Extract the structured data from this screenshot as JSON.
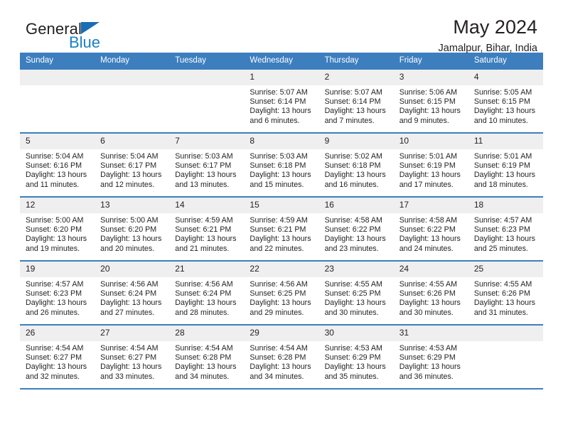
{
  "brand": {
    "name_part1": "General",
    "name_part2": "Blue",
    "logo_icon": "triangle-flag-icon"
  },
  "header": {
    "title": "May 2024",
    "subtitle": "Jamalpur, Bihar, India"
  },
  "weekday_headers": [
    "Sunday",
    "Monday",
    "Tuesday",
    "Wednesday",
    "Thursday",
    "Friday",
    "Saturday"
  ],
  "labels": {
    "sunrise_prefix": "Sunrise:",
    "sunset_prefix": "Sunset:",
    "daylight_prefix": "Daylight:"
  },
  "colors": {
    "header_blue": "#3d7ebf",
    "daynum_band": "#efefef",
    "brand_blue": "#1a7ec4",
    "text": "#231f20"
  },
  "weeks": [
    [
      {
        "day": "",
        "empty": true
      },
      {
        "day": "",
        "empty": true
      },
      {
        "day": "",
        "empty": true
      },
      {
        "day": "1",
        "sunrise": "Sunrise: 5:07 AM",
        "sunset": "Sunset: 6:14 PM",
        "daylight": "Daylight: 13 hours and 6 minutes."
      },
      {
        "day": "2",
        "sunrise": "Sunrise: 5:07 AM",
        "sunset": "Sunset: 6:14 PM",
        "daylight": "Daylight: 13 hours and 7 minutes."
      },
      {
        "day": "3",
        "sunrise": "Sunrise: 5:06 AM",
        "sunset": "Sunset: 6:15 PM",
        "daylight": "Daylight: 13 hours and 9 minutes."
      },
      {
        "day": "4",
        "sunrise": "Sunrise: 5:05 AM",
        "sunset": "Sunset: 6:15 PM",
        "daylight": "Daylight: 13 hours and 10 minutes."
      }
    ],
    [
      {
        "day": "5",
        "sunrise": "Sunrise: 5:04 AM",
        "sunset": "Sunset: 6:16 PM",
        "daylight": "Daylight: 13 hours and 11 minutes."
      },
      {
        "day": "6",
        "sunrise": "Sunrise: 5:04 AM",
        "sunset": "Sunset: 6:17 PM",
        "daylight": "Daylight: 13 hours and 12 minutes."
      },
      {
        "day": "7",
        "sunrise": "Sunrise: 5:03 AM",
        "sunset": "Sunset: 6:17 PM",
        "daylight": "Daylight: 13 hours and 13 minutes."
      },
      {
        "day": "8",
        "sunrise": "Sunrise: 5:03 AM",
        "sunset": "Sunset: 6:18 PM",
        "daylight": "Daylight: 13 hours and 15 minutes."
      },
      {
        "day": "9",
        "sunrise": "Sunrise: 5:02 AM",
        "sunset": "Sunset: 6:18 PM",
        "daylight": "Daylight: 13 hours and 16 minutes."
      },
      {
        "day": "10",
        "sunrise": "Sunrise: 5:01 AM",
        "sunset": "Sunset: 6:19 PM",
        "daylight": "Daylight: 13 hours and 17 minutes."
      },
      {
        "day": "11",
        "sunrise": "Sunrise: 5:01 AM",
        "sunset": "Sunset: 6:19 PM",
        "daylight": "Daylight: 13 hours and 18 minutes."
      }
    ],
    [
      {
        "day": "12",
        "sunrise": "Sunrise: 5:00 AM",
        "sunset": "Sunset: 6:20 PM",
        "daylight": "Daylight: 13 hours and 19 minutes."
      },
      {
        "day": "13",
        "sunrise": "Sunrise: 5:00 AM",
        "sunset": "Sunset: 6:20 PM",
        "daylight": "Daylight: 13 hours and 20 minutes."
      },
      {
        "day": "14",
        "sunrise": "Sunrise: 4:59 AM",
        "sunset": "Sunset: 6:21 PM",
        "daylight": "Daylight: 13 hours and 21 minutes."
      },
      {
        "day": "15",
        "sunrise": "Sunrise: 4:59 AM",
        "sunset": "Sunset: 6:21 PM",
        "daylight": "Daylight: 13 hours and 22 minutes."
      },
      {
        "day": "16",
        "sunrise": "Sunrise: 4:58 AM",
        "sunset": "Sunset: 6:22 PM",
        "daylight": "Daylight: 13 hours and 23 minutes."
      },
      {
        "day": "17",
        "sunrise": "Sunrise: 4:58 AM",
        "sunset": "Sunset: 6:22 PM",
        "daylight": "Daylight: 13 hours and 24 minutes."
      },
      {
        "day": "18",
        "sunrise": "Sunrise: 4:57 AM",
        "sunset": "Sunset: 6:23 PM",
        "daylight": "Daylight: 13 hours and 25 minutes."
      }
    ],
    [
      {
        "day": "19",
        "sunrise": "Sunrise: 4:57 AM",
        "sunset": "Sunset: 6:23 PM",
        "daylight": "Daylight: 13 hours and 26 minutes."
      },
      {
        "day": "20",
        "sunrise": "Sunrise: 4:56 AM",
        "sunset": "Sunset: 6:24 PM",
        "daylight": "Daylight: 13 hours and 27 minutes."
      },
      {
        "day": "21",
        "sunrise": "Sunrise: 4:56 AM",
        "sunset": "Sunset: 6:24 PM",
        "daylight": "Daylight: 13 hours and 28 minutes."
      },
      {
        "day": "22",
        "sunrise": "Sunrise: 4:56 AM",
        "sunset": "Sunset: 6:25 PM",
        "daylight": "Daylight: 13 hours and 29 minutes."
      },
      {
        "day": "23",
        "sunrise": "Sunrise: 4:55 AM",
        "sunset": "Sunset: 6:25 PM",
        "daylight": "Daylight: 13 hours and 30 minutes."
      },
      {
        "day": "24",
        "sunrise": "Sunrise: 4:55 AM",
        "sunset": "Sunset: 6:26 PM",
        "daylight": "Daylight: 13 hours and 30 minutes."
      },
      {
        "day": "25",
        "sunrise": "Sunrise: 4:55 AM",
        "sunset": "Sunset: 6:26 PM",
        "daylight": "Daylight: 13 hours and 31 minutes."
      }
    ],
    [
      {
        "day": "26",
        "sunrise": "Sunrise: 4:54 AM",
        "sunset": "Sunset: 6:27 PM",
        "daylight": "Daylight: 13 hours and 32 minutes."
      },
      {
        "day": "27",
        "sunrise": "Sunrise: 4:54 AM",
        "sunset": "Sunset: 6:27 PM",
        "daylight": "Daylight: 13 hours and 33 minutes."
      },
      {
        "day": "28",
        "sunrise": "Sunrise: 4:54 AM",
        "sunset": "Sunset: 6:28 PM",
        "daylight": "Daylight: 13 hours and 34 minutes."
      },
      {
        "day": "29",
        "sunrise": "Sunrise: 4:54 AM",
        "sunset": "Sunset: 6:28 PM",
        "daylight": "Daylight: 13 hours and 34 minutes."
      },
      {
        "day": "30",
        "sunrise": "Sunrise: 4:53 AM",
        "sunset": "Sunset: 6:29 PM",
        "daylight": "Daylight: 13 hours and 35 minutes."
      },
      {
        "day": "31",
        "sunrise": "Sunrise: 4:53 AM",
        "sunset": "Sunset: 6:29 PM",
        "daylight": "Daylight: 13 hours and 36 minutes."
      },
      {
        "day": "",
        "empty": true
      }
    ]
  ]
}
